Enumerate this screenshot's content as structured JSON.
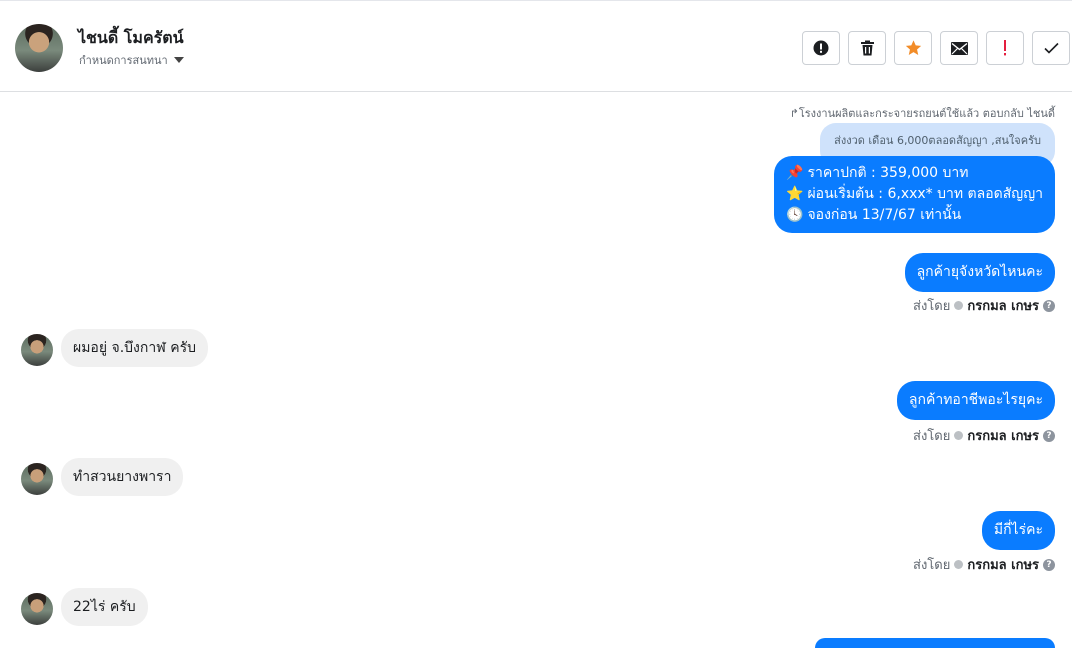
{
  "header": {
    "name": "ไชนดี้ โมครัตน์",
    "subtitle": "กำหนดการสนทนา"
  },
  "actions": [
    {
      "name": "alert-icon",
      "color": "#1c1e21"
    },
    {
      "name": "trash-icon",
      "color": "#1c1e21"
    },
    {
      "name": "star-icon",
      "color": "#f28c28"
    },
    {
      "name": "envelope-icon",
      "color": "#1c1e21"
    },
    {
      "name": "exclamation-icon",
      "color": "#e41e3f"
    },
    {
      "name": "check-icon",
      "color": "#1c1e21"
    }
  ],
  "thread": {
    "reply_note": "↱โรงงานผลิตและกระจายรถยนต์ใช้แล้ว ตอบกลับ ไชนดี้",
    "quoted": "ส่งงวด เดือน 6,000ตลอดสัญญา ,สนใจครับ",
    "promo": {
      "line1_icon": "📌",
      "line1": "ราคาปกติ  : 359,000 บาท",
      "line2_icon": "⭐",
      "line2": "ผ่อนเริ่มต้น  : 6,xxx* บาท ตลอดสัญญา",
      "line3_icon": "🕓",
      "line3": "จองก่อน 13/7/67 เท่านั้น"
    },
    "out1": "ลูกค้ายุจังหวัดไหนคะ",
    "out2": "ลูกค้าทอาชีพอะไรยุคะ",
    "out3": "มีกี่ไร่คะ",
    "sent_by_label": "ส่งโดย",
    "sent_by_name": "กรกมล เกษร",
    "in1": "ผมอยู่ จ.บึงกาฬ ครับ",
    "in2": "ทำสวนยางพารา",
    "in3": "22ไร่ ครับ"
  },
  "colors": {
    "outgoing": "#0a7cff",
    "incoming": "#f0f0f0",
    "quoted": "#cfe2fb"
  }
}
